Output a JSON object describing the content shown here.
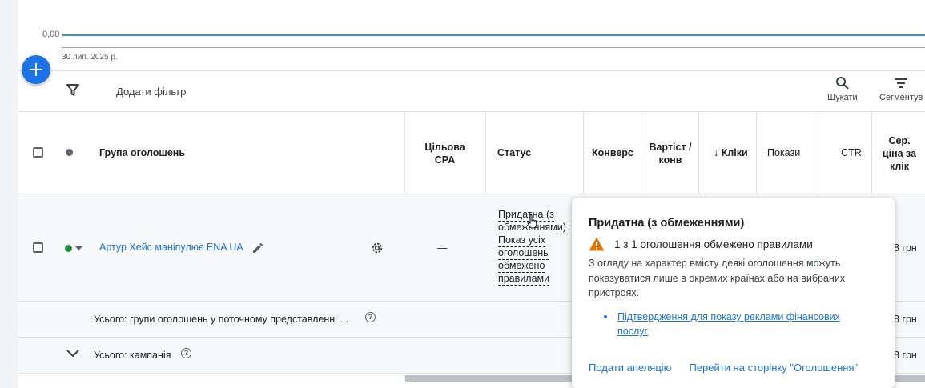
{
  "chart": {
    "y_tick": "0,00",
    "x_tick": "30 лип. 2025 р."
  },
  "toolbar": {
    "add_filter": "Додати фільтр",
    "search_label": "Шукати",
    "segment_label": "Сегментув"
  },
  "table": {
    "headers": {
      "ad_group": "Група оголошень",
      "target_cpa": "Цільова CPA",
      "status": "Статус",
      "conversions": "Конверс",
      "cost_per_conv": "Вартіст / конв",
      "clicks": "Кліки",
      "impressions": "Покази",
      "ctr": "CTR",
      "avg_cpc": "Сер. ціна за клік"
    },
    "row": {
      "ad_group_name": "Артур Хейс маніпулює ENA UA",
      "target_cpa": "—",
      "status_lines": [
        "Придатна (з",
        "обмеженнями)",
        "Показ усіх",
        "оголошень",
        "обмежено",
        "правилами"
      ],
      "avg_cpc": "8 грн",
      "status_color": "#1e8e3e"
    },
    "total_view": {
      "label": "Усього: групи оголошень у поточному представленні ...",
      "avg_cpc": "8 грн"
    },
    "total_campaign": {
      "label": "Усього: кампанія",
      "avg_cpc": "8 грн"
    }
  },
  "popup": {
    "title": "Придатна (з обмеженнями)",
    "warning": "1 з 1 оголошення обмежено правилами",
    "description": "З огляду на характер вмісту деякі оголошення можуть показуватися лише в окремих країнах або на вибраних пристроях.",
    "link": "Підтвердження для показу реклами фінансових послуг",
    "action_appeal": "Подати апеляцію",
    "action_ads_page": "Перейти на сторінку \"Оголошення\"",
    "warning_color": "#e37400"
  },
  "colors": {
    "accent": "#1a73e8"
  }
}
